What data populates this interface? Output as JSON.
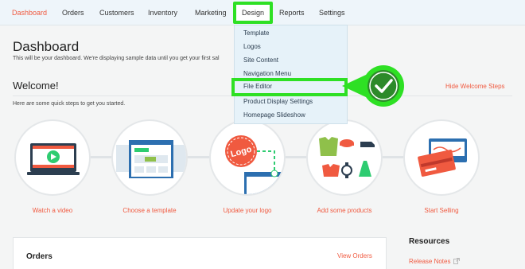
{
  "nav": {
    "items": [
      "Dashboard",
      "Orders",
      "Customers",
      "Inventory",
      "Marketing"
    ],
    "design": "Design",
    "after": [
      "Reports",
      "Settings"
    ]
  },
  "header": {
    "title": "Dashboard",
    "subtitle": "This will be your dashboard. We're displaying sample data until you get your first sal"
  },
  "welcome": {
    "title": "Welcome!",
    "hide": "Hide Welcome Steps",
    "intro": "Here are some quick steps to get you started."
  },
  "steps": [
    {
      "label": "Watch a video",
      "icon": "video-player-icon"
    },
    {
      "label": "Choose a template",
      "icon": "template-icon"
    },
    {
      "label": "Update your logo",
      "icon": "logo-icon"
    },
    {
      "label": "Add some products",
      "icon": "products-icon"
    },
    {
      "label": "Start Selling",
      "icon": "credit-cards-icon"
    }
  ],
  "logo_text": "Logo",
  "dropdown": {
    "items": [
      "Template",
      "Logos",
      "Site Content",
      "Navigation Menu"
    ],
    "highlighted": "File Editor",
    "items_after": [
      "Product Display Settings",
      "Homepage Slideshow"
    ]
  },
  "orders": {
    "title": "Orders",
    "view": "View Orders"
  },
  "resources": {
    "title": "Resources",
    "release_notes": "Release Notes"
  },
  "colors": {
    "accent": "#f05a40",
    "highlight": "#2ee024",
    "nav_bg": "#eef5fa"
  }
}
